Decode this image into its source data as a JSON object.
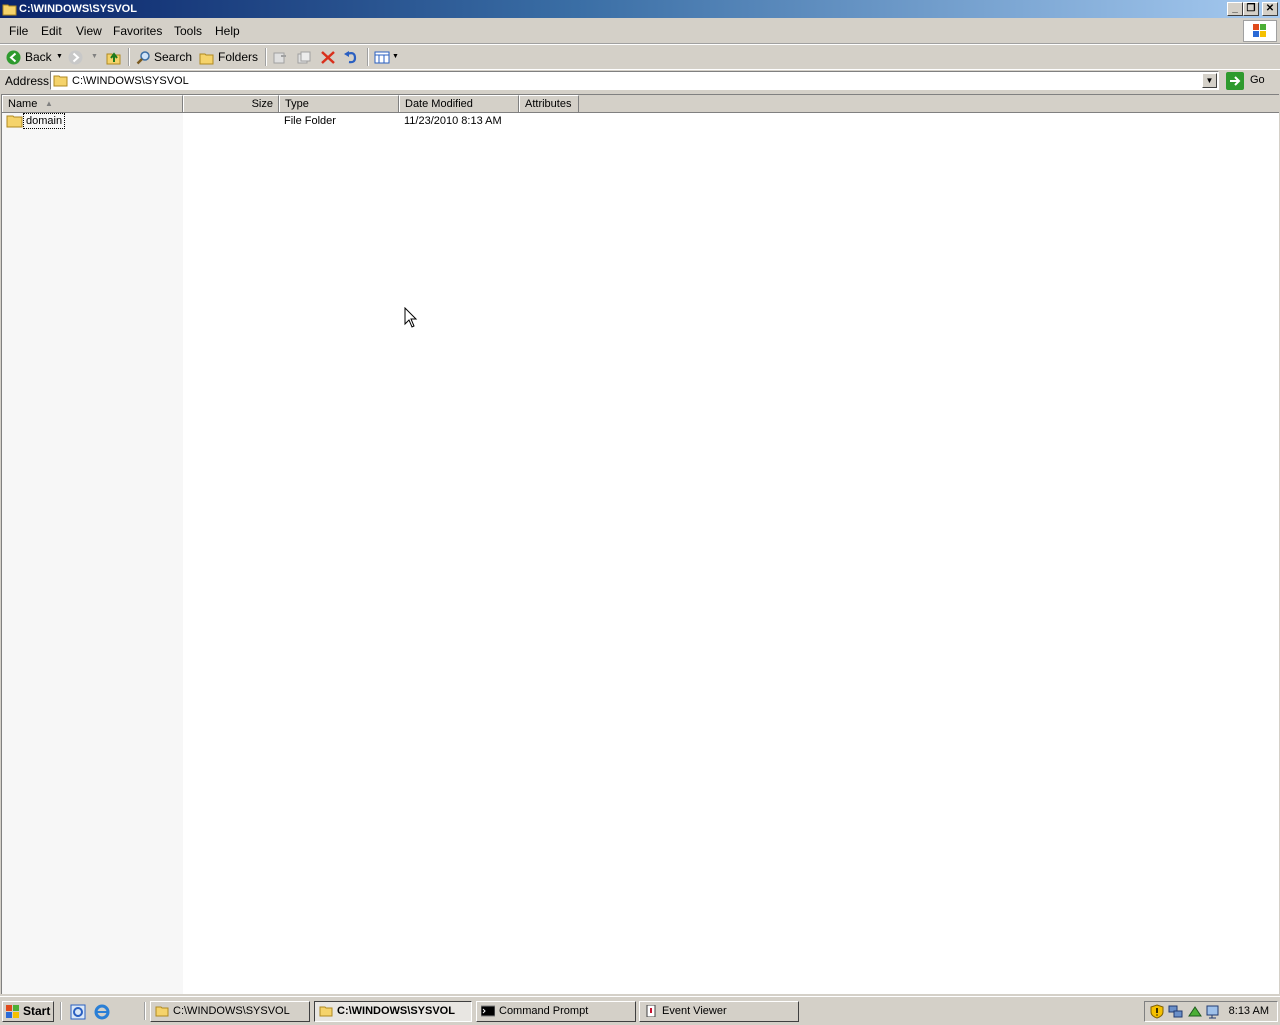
{
  "window": {
    "title": "C:\\WINDOWS\\SYSVOL"
  },
  "menu": {
    "items": [
      "File",
      "Edit",
      "View",
      "Favorites",
      "Tools",
      "Help"
    ]
  },
  "toolbar": {
    "back": "Back",
    "search": "Search",
    "folders": "Folders"
  },
  "address": {
    "label": "Address",
    "value": "C:\\WINDOWS\\SYSVOL",
    "go": "Go"
  },
  "columns": {
    "name": "Name",
    "size": "Size",
    "type": "Type",
    "date": "Date Modified",
    "attributes": "Attributes"
  },
  "files": [
    {
      "name": "domain",
      "size": "",
      "type": "File Folder",
      "date": "11/23/2010 8:13 AM",
      "attributes": ""
    }
  ],
  "taskbar": {
    "start": "Start",
    "tasks": [
      {
        "label": "C:\\WINDOWS\\SYSVOL",
        "icon": "folder-icon",
        "active": false
      },
      {
        "label": "C:\\WINDOWS\\SYSVOL",
        "icon": "folder-icon",
        "active": true
      },
      {
        "label": "Command Prompt",
        "icon": "command-prompt-icon",
        "active": false
      },
      {
        "label": "Event Viewer",
        "icon": "event-viewer-icon",
        "active": false
      }
    ],
    "clock": "8:13 AM"
  },
  "colors": {
    "titlebar_start": "#0a246a",
    "titlebar_end": "#a6caf0",
    "face": "#d4d0c8"
  }
}
